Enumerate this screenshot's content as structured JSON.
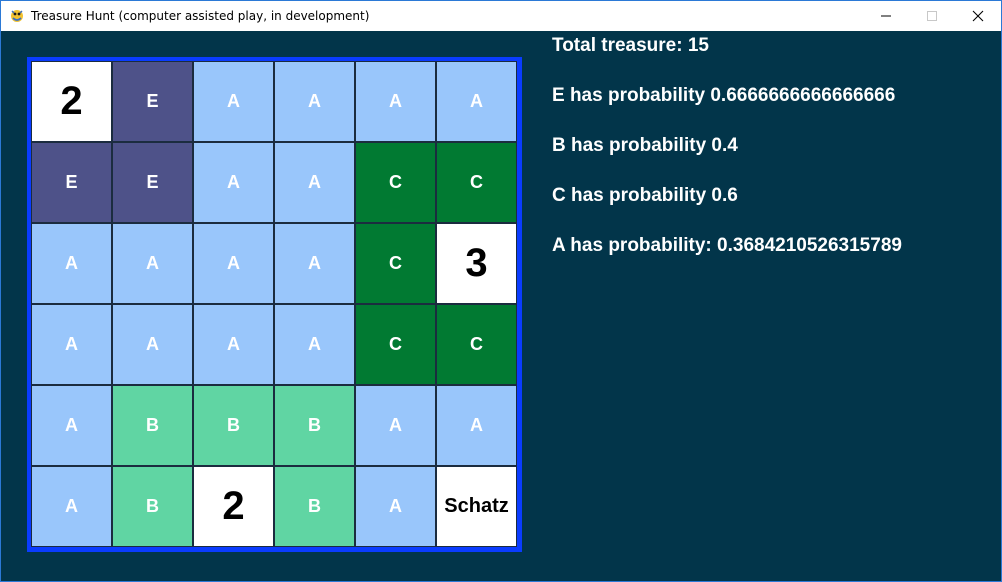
{
  "window": {
    "title": "Treasure Hunt (computer assisted play, in development)",
    "app_icon": "pygame-snake-icon",
    "controls": [
      "minimize-icon",
      "maximize-icon",
      "close-icon"
    ]
  },
  "board": {
    "rows": 6,
    "cols": 6,
    "colors": {
      "A": "#99c6fb",
      "B": "#60d5a3",
      "C": "#017a32",
      "E": "#4e5289",
      "revealed": "#ffffff",
      "border": "#0a3cff"
    },
    "cells": [
      [
        {
          "text": "2",
          "kind": "revealed"
        },
        {
          "text": "E",
          "kind": "E"
        },
        {
          "text": "A",
          "kind": "A"
        },
        {
          "text": "A",
          "kind": "A"
        },
        {
          "text": "A",
          "kind": "A"
        },
        {
          "text": "A",
          "kind": "A"
        }
      ],
      [
        {
          "text": "E",
          "kind": "E"
        },
        {
          "text": "E",
          "kind": "E"
        },
        {
          "text": "A",
          "kind": "A"
        },
        {
          "text": "A",
          "kind": "A"
        },
        {
          "text": "C",
          "kind": "C"
        },
        {
          "text": "C",
          "kind": "C"
        }
      ],
      [
        {
          "text": "A",
          "kind": "A"
        },
        {
          "text": "A",
          "kind": "A"
        },
        {
          "text": "A",
          "kind": "A"
        },
        {
          "text": "A",
          "kind": "A"
        },
        {
          "text": "C",
          "kind": "C"
        },
        {
          "text": "3",
          "kind": "revealed"
        }
      ],
      [
        {
          "text": "A",
          "kind": "A"
        },
        {
          "text": "A",
          "kind": "A"
        },
        {
          "text": "A",
          "kind": "A"
        },
        {
          "text": "A",
          "kind": "A"
        },
        {
          "text": "C",
          "kind": "C"
        },
        {
          "text": "C",
          "kind": "C"
        }
      ],
      [
        {
          "text": "A",
          "kind": "A"
        },
        {
          "text": "B",
          "kind": "B"
        },
        {
          "text": "B",
          "kind": "B"
        },
        {
          "text": "B",
          "kind": "B"
        },
        {
          "text": "A",
          "kind": "A"
        },
        {
          "text": "A",
          "kind": "A"
        }
      ],
      [
        {
          "text": "A",
          "kind": "A"
        },
        {
          "text": "B",
          "kind": "B"
        },
        {
          "text": "2",
          "kind": "revealed"
        },
        {
          "text": "B",
          "kind": "B"
        },
        {
          "text": "A",
          "kind": "A"
        },
        {
          "text": "Schatz",
          "kind": "treasure"
        }
      ]
    ]
  },
  "info": {
    "total_treasure": "Total treasure: 15",
    "probabilities": [
      "E has probability 0.6666666666666666",
      "B has probability 0.4",
      "C has probability 0.6",
      "A has probability: 0.3684210526315789"
    ]
  }
}
